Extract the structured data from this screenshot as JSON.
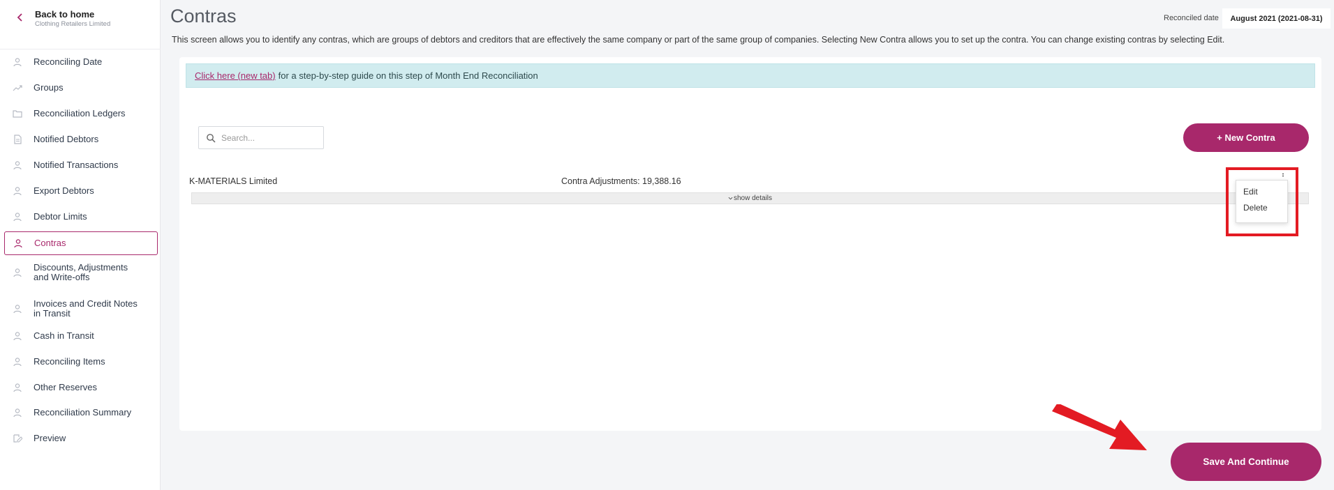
{
  "sidebar": {
    "back": {
      "title": "Back to home",
      "subtitle": "Clothing Retailers Limited"
    },
    "items": [
      {
        "label": "Reconciling Date",
        "icon": "user-icon"
      },
      {
        "label": "Groups",
        "icon": "trend-icon"
      },
      {
        "label": "Reconciliation Ledgers",
        "icon": "folder-icon"
      },
      {
        "label": "Notified Debtors",
        "icon": "document-icon"
      },
      {
        "label": "Notified Transactions",
        "icon": "user-icon"
      },
      {
        "label": "Export Debtors",
        "icon": "user-icon"
      },
      {
        "label": "Debtor Limits",
        "icon": "user-icon"
      },
      {
        "label": "Contras",
        "icon": "user-icon",
        "active": true
      },
      {
        "label": "Discounts, Adjustments and Write-offs",
        "icon": "user-icon"
      },
      {
        "label": "Invoices and Credit Notes in Transit",
        "icon": "user-icon"
      },
      {
        "label": "Cash in Transit",
        "icon": "user-icon"
      },
      {
        "label": "Reconciling Items",
        "icon": "user-icon"
      },
      {
        "label": "Other Reserves",
        "icon": "user-icon"
      },
      {
        "label": "Reconciliation Summary",
        "icon": "user-icon"
      },
      {
        "label": "Preview",
        "icon": "edit-icon"
      }
    ]
  },
  "header": {
    "title": "Contras",
    "reconciled_label": "Reconciled date",
    "reconciled_value": "August 2021 (2021-08-31)",
    "description": "This screen allows you to identify any contras, which are groups of debtors and creditors that are effectively the same company or part of the same group of companies. Selecting New Contra allows you to set up the contra. You can change existing contras by selecting Edit."
  },
  "info": {
    "link_text": "Click here (new tab)",
    "text": "for a step-by-step guide on this step of Month End Reconciliation"
  },
  "search": {
    "placeholder": "Search..."
  },
  "new_contra_label": "+ New Contra",
  "contras": [
    {
      "name": "K-MATERIALS Limited",
      "adjustments": "Contra Adjustments: 19,388.16",
      "details_label": "show details"
    }
  ],
  "menu": {
    "edit": "Edit",
    "delete": "Delete"
  },
  "save_label": "Save And Continue",
  "colors": {
    "accent": "#a8286b",
    "info_bg": "#d1ecef",
    "highlight": "#e31b23"
  }
}
